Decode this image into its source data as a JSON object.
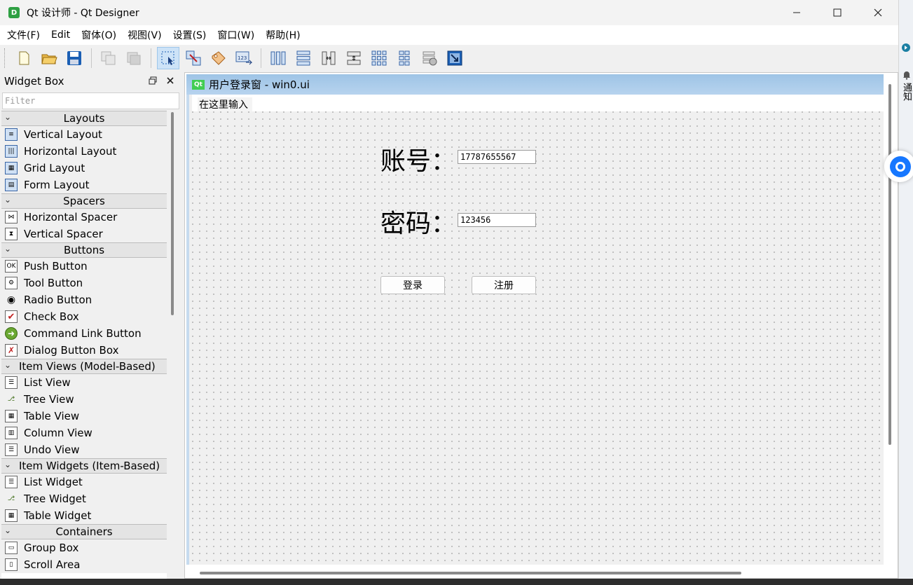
{
  "window": {
    "title": "Qt 设计师 - Qt Designer",
    "icon_letter": "D",
    "controls": [
      "minimize-icon",
      "maximize-icon",
      "close-icon"
    ]
  },
  "menubar": {
    "items": [
      "文件(F)",
      "Edit",
      "窗体(O)",
      "视图(V)",
      "设置(S)",
      "窗口(W)",
      "帮助(H)"
    ]
  },
  "widget_box": {
    "title": "Widget Box",
    "filter_placeholder": "Filter",
    "categories": [
      {
        "label": "Layouts",
        "items": [
          "Vertical Layout",
          "Horizontal Layout",
          "Grid Layout",
          "Form Layout"
        ]
      },
      {
        "label": "Spacers",
        "items": [
          "Horizontal Spacer",
          "Vertical Spacer"
        ]
      },
      {
        "label": "Buttons",
        "items": [
          "Push Button",
          "Tool Button",
          "Radio Button",
          "Check Box",
          "Command Link Button",
          "Dialog Button Box"
        ]
      },
      {
        "label": "Item Views (Model-Based)",
        "items": [
          "List View",
          "Tree View",
          "Table View",
          "Column View",
          "Undo View"
        ]
      },
      {
        "label": "Item Widgets (Item-Based)",
        "items": [
          "List Widget",
          "Tree Widget",
          "Table Widget"
        ]
      },
      {
        "label": "Containers",
        "items": [
          "Group Box",
          "Scroll Area"
        ]
      }
    ]
  },
  "form_window": {
    "badge": "Qt",
    "title": "用户登录窗 - win0.ui",
    "menu_placeholder": "在这里输入",
    "account_label": "账号：",
    "account_value": "17787655567",
    "password_label": "密码：",
    "password_value": "123456",
    "login_button": "登录",
    "register_button": "注册"
  },
  "side_panel": {
    "notify_label": "通知"
  },
  "colors": {
    "accent": "#1677ff",
    "subwindow_title": "#9ec4e6",
    "qt_green": "#41cd52"
  }
}
